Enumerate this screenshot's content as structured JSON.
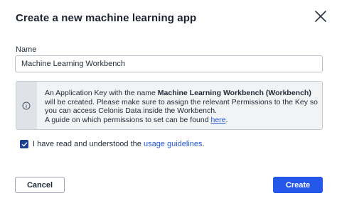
{
  "dialog": {
    "title": "Create a new machine learning app",
    "close_icon": "close-icon"
  },
  "name_field": {
    "label": "Name",
    "value": "Machine Learning Workbench"
  },
  "info": {
    "icon": "info-icon",
    "text_before": "An Application Key with the name ",
    "key_name": "Machine Learning Workbench (Workbench)",
    "text_after": " will be created. Please make sure to assign the relevant Permissions to the Key so you can access Celonis Data inside the Workbench.",
    "guide_text": "A guide on which permissions to set can be found ",
    "guide_link": "here",
    "guide_end": "."
  },
  "agreement": {
    "checked": true,
    "text": "I have read and understood the ",
    "link": "usage guidelines",
    "end": "."
  },
  "buttons": {
    "cancel": "Cancel",
    "create": "Create"
  },
  "colors": {
    "primary": "#2457ea",
    "checkbox": "#1c3f8f",
    "link": "#2456d6"
  }
}
